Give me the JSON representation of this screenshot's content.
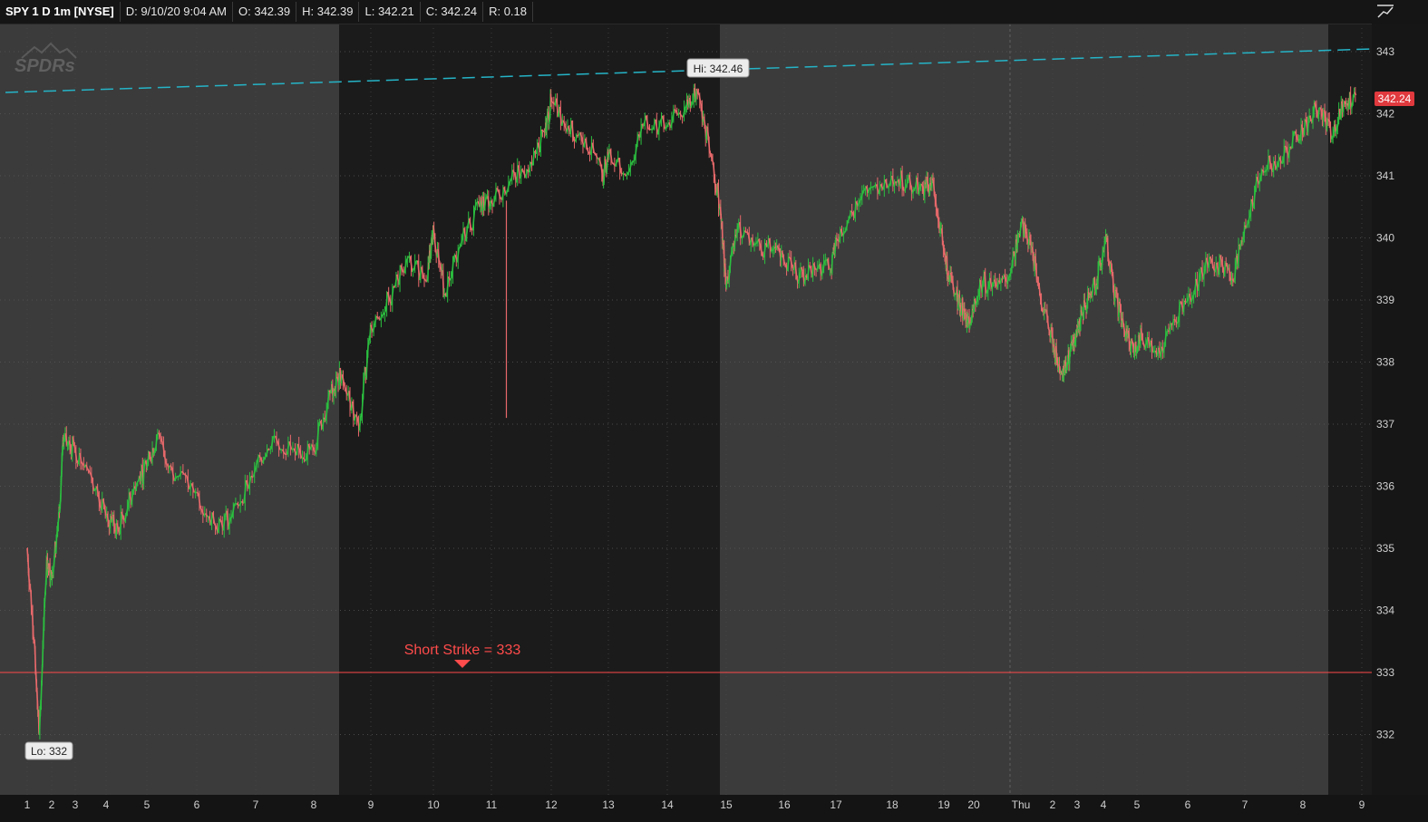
{
  "header": {
    "symbol": "SPY 1 D 1m [NYSE]",
    "date": "D: 9/10/20 9:04 AM",
    "open": "O: 342.39",
    "high": "H: 342.39",
    "low": "L: 342.21",
    "close": "C: 342.24",
    "range": "R: 0.18"
  },
  "watermark": {
    "text": "SPDRs"
  },
  "annotations": {
    "hi_label": "Hi: 342.46",
    "lo_label": "Lo: 332",
    "short_strike_label": "Short Strike = 333",
    "last_price_label": "342.24"
  },
  "colors": {
    "up": "#2bbf3f",
    "down": "#e8696b",
    "strike_line": "#ff4b4b",
    "trend_line": "#25b4c7",
    "last_price_bg": "#e0393e",
    "session_light": "#3b3b3b",
    "session_dark": "#1b1b1b"
  },
  "icons": {
    "corner": "chart-style-icon"
  },
  "chart_data": {
    "type": "line",
    "title": "SPY 1 D 1m [NYSE]",
    "x_ticks": [
      "1",
      "2",
      "3",
      "4",
      "5",
      "6",
      "7",
      "8",
      "9",
      "10",
      "11",
      "12",
      "13",
      "14",
      "15",
      "16",
      "17",
      "18",
      "19",
      "20",
      "Thu",
      "2",
      "3",
      "4",
      "5",
      "6",
      "7",
      "8",
      "9"
    ],
    "y_ticks": [
      332,
      333,
      334,
      335,
      336,
      337,
      338,
      339,
      340,
      341,
      342,
      343
    ],
    "ylim": [
      331.2,
      343.4
    ],
    "grid": true,
    "series": [
      {
        "values": [
          [
            1.0,
            335.0
          ],
          [
            1.3,
            333.5
          ],
          [
            1.5,
            332.0
          ],
          [
            1.8,
            334.8
          ],
          [
            2.0,
            334.5
          ],
          [
            2.3,
            335.5
          ],
          [
            2.5,
            336.7
          ],
          [
            3.0,
            336.6
          ],
          [
            3.5,
            336.2
          ],
          [
            4.0,
            335.5
          ],
          [
            4.3,
            335.3
          ],
          [
            4.7,
            336.0
          ],
          [
            5.0,
            336.3
          ],
          [
            5.2,
            336.8
          ],
          [
            5.5,
            336.3
          ],
          [
            6.0,
            335.9
          ],
          [
            6.3,
            335.4
          ],
          [
            6.6,
            335.5
          ],
          [
            7.0,
            336.3
          ],
          [
            7.3,
            336.8
          ],
          [
            7.7,
            336.5
          ],
          [
            8.0,
            336.6
          ],
          [
            8.3,
            337.5
          ],
          [
            8.5,
            337.8
          ],
          [
            8.8,
            336.9
          ],
          [
            9.0,
            338.6
          ],
          [
            9.3,
            339.0
          ],
          [
            9.6,
            339.7
          ],
          [
            9.9,
            339.3
          ],
          [
            10.0,
            340.2
          ],
          [
            10.2,
            339.1
          ],
          [
            10.5,
            340.0
          ],
          [
            10.8,
            340.5
          ],
          [
            11.0,
            340.6
          ],
          [
            11.3,
            340.9
          ],
          [
            11.6,
            341.1
          ],
          [
            11.9,
            341.7
          ],
          [
            12.0,
            342.2
          ],
          [
            12.3,
            341.8
          ],
          [
            12.6,
            341.6
          ],
          [
            12.9,
            341.0
          ],
          [
            13.0,
            341.3
          ],
          [
            13.3,
            341.0
          ],
          [
            13.6,
            341.8
          ],
          [
            14.0,
            341.8
          ],
          [
            14.3,
            342.1
          ],
          [
            14.5,
            342.4
          ],
          [
            14.7,
            341.6
          ],
          [
            14.9,
            340.5
          ],
          [
            15.0,
            339.2
          ],
          [
            15.2,
            340.2
          ],
          [
            15.5,
            339.9
          ],
          [
            15.8,
            339.8
          ],
          [
            16.0,
            339.6
          ],
          [
            16.3,
            339.4
          ],
          [
            16.6,
            339.5
          ],
          [
            16.9,
            339.5
          ],
          [
            17.0,
            340.0
          ],
          [
            17.3,
            340.4
          ],
          [
            17.6,
            340.8
          ],
          [
            18.0,
            341.0
          ],
          [
            18.3,
            340.9
          ],
          [
            18.6,
            340.8
          ],
          [
            18.8,
            340.9
          ],
          [
            19.0,
            339.8
          ],
          [
            19.2,
            339.3
          ],
          [
            19.5,
            339.0
          ],
          [
            19.7,
            338.8
          ],
          [
            19.9,
            338.6
          ],
          [
            20.2,
            339.3
          ],
          [
            20.5,
            339.2
          ],
          [
            20.8,
            339.5
          ],
          [
            21.0,
            340.2
          ],
          [
            21.3,
            340.0
          ],
          [
            21.6,
            339.1
          ],
          [
            21.9,
            338.5
          ],
          [
            22.2,
            338.0
          ],
          [
            22.5,
            337.8
          ],
          [
            22.8,
            338.3
          ],
          [
            23.0,
            338.5
          ],
          [
            23.3,
            338.9
          ],
          [
            23.6,
            339.2
          ],
          [
            23.9,
            339.5
          ],
          [
            24.1,
            340.0
          ],
          [
            24.3,
            339.2
          ],
          [
            24.6,
            338.6
          ],
          [
            24.9,
            338.2
          ],
          [
            25.1,
            338.4
          ],
          [
            25.4,
            338.1
          ],
          [
            25.7,
            338.6
          ],
          [
            26.0,
            339.0
          ],
          [
            26.3,
            339.5
          ],
          [
            26.6,
            339.6
          ],
          [
            26.8,
            339.3
          ],
          [
            27.0,
            340.2
          ],
          [
            27.3,
            341.1
          ],
          [
            27.6,
            341.3
          ],
          [
            27.9,
            341.6
          ],
          [
            28.1,
            341.9
          ],
          [
            28.3,
            342.1
          ],
          [
            28.5,
            341.6
          ],
          [
            28.7,
            342.2
          ],
          [
            28.9,
            342.3
          ]
        ]
      }
    ],
    "hi": 342.46,
    "lo": 332,
    "short_strike": 333,
    "last_price": 342.24
  }
}
